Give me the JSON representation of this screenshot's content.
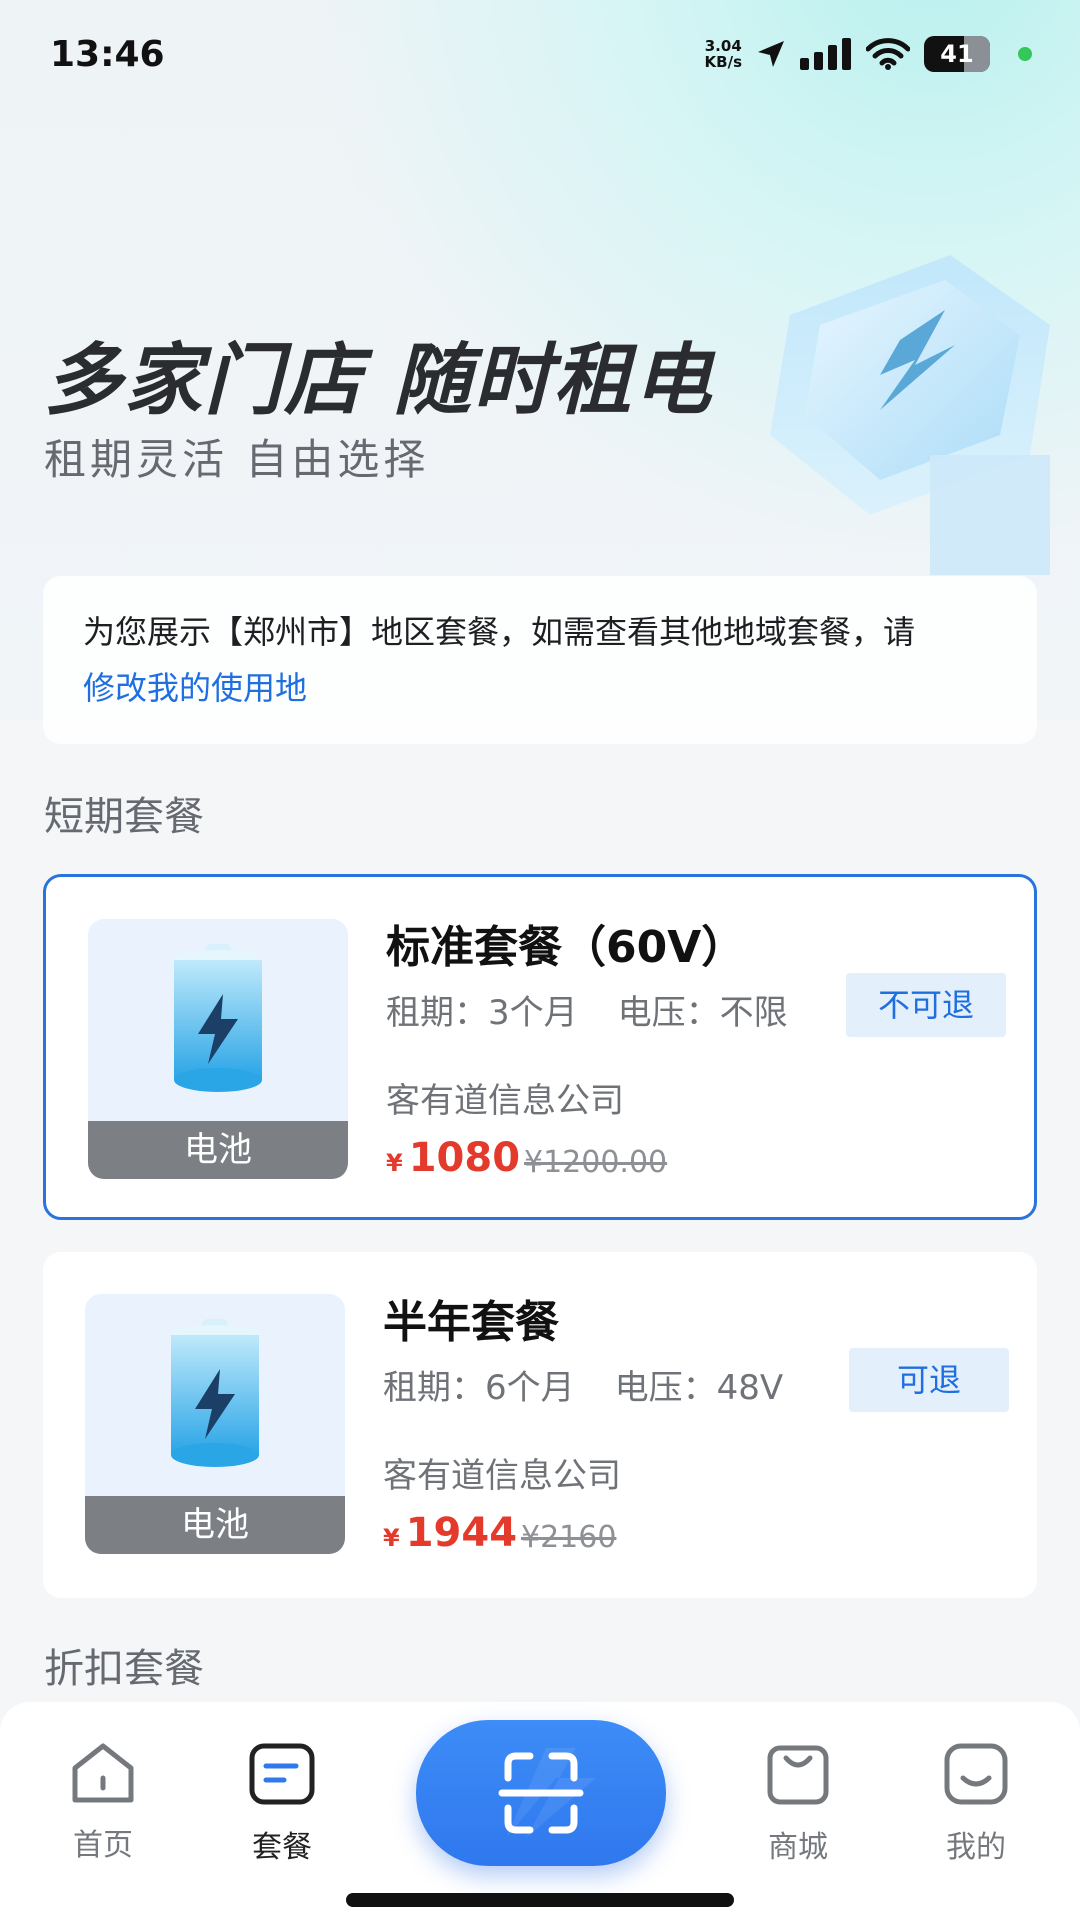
{
  "status_bar": {
    "time": "13:46",
    "net_speed_value": "3.04",
    "net_speed_unit": "KB/s",
    "battery": "41"
  },
  "hero": {
    "title": "多家门店 随时租电",
    "subtitle": "租期灵活 自由选择"
  },
  "notice": {
    "text": "为您展示【郑州市】地区套餐，如需查看其他地域套餐，请",
    "link": "修改我的使用地"
  },
  "sections": {
    "short_term": "短期套餐",
    "discount": "折扣套餐"
  },
  "packages": [
    {
      "title": "标准套餐（60V）",
      "term": "租期：3个月",
      "voltage": "电压：不限",
      "refund_tag": "不可退",
      "company": "客有道信息公司",
      "currency": "¥",
      "price": "1080",
      "original_price": "¥1200.00",
      "thumb_label": "电池",
      "selected": true
    },
    {
      "title": "半年套餐",
      "term": "租期：6个月",
      "voltage": "电压：48V",
      "refund_tag": "可退",
      "company": "客有道信息公司",
      "currency": "¥",
      "price": "1944",
      "original_price": "¥2160",
      "thumb_label": "电池",
      "selected": false
    }
  ],
  "tabbar": {
    "items": [
      {
        "label": "首页",
        "icon": "home-icon"
      },
      {
        "label": "套餐",
        "icon": "package-icon"
      },
      {
        "label": "",
        "icon": "scan-icon"
      },
      {
        "label": "商城",
        "icon": "shopping-bag-icon"
      },
      {
        "label": "我的",
        "icon": "profile-icon"
      }
    ],
    "active_index": 1
  },
  "colors": {
    "accent_blue": "#2a73df",
    "price_red": "#e33a2c",
    "tag_bg": "#e4effc"
  }
}
